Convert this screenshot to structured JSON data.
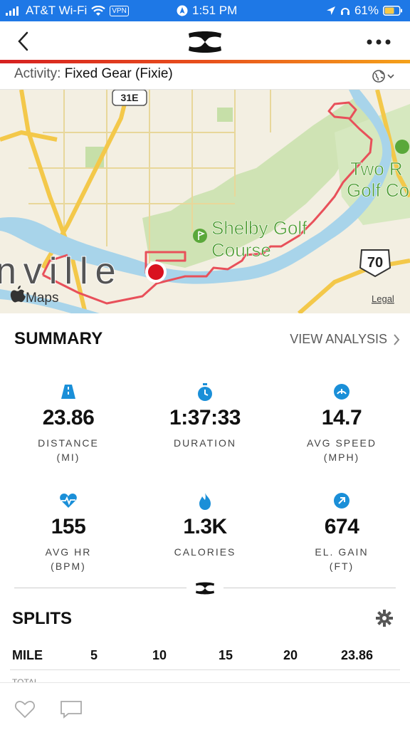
{
  "status": {
    "carrier": "AT&T Wi-Fi",
    "vpn": "VPN",
    "time": "1:51 PM",
    "battery": "61%"
  },
  "nav": {
    "back_icon": "chevron-left-icon",
    "logo_icon": "under-armour-logo",
    "more_icon": "more-dots-icon"
  },
  "activity": {
    "label": "Activity:",
    "value": "Fixed Gear (Fixie)"
  },
  "map": {
    "road_sign_1": "31E",
    "road_sign_2": "70",
    "place_1_line1": "Shelby Golf",
    "place_1_line2": "Course",
    "place_2_line1": "Two R",
    "place_2_line2": "Golf Co",
    "city_fragment": "nville",
    "maps_label": "Maps",
    "legal_label": "Legal"
  },
  "summary": {
    "title": "SUMMARY",
    "view_analysis": "VIEW ANALYSIS",
    "stats": [
      {
        "value": "23.86",
        "label": "DISTANCE",
        "unit": "(MI)"
      },
      {
        "value": "1:37:33",
        "label": "DURATION",
        "unit": ""
      },
      {
        "value": "14.7",
        "label": "AVG SPEED",
        "unit": "(MPH)"
      },
      {
        "value": "155",
        "label": "AVG HR",
        "unit": "(BPM)"
      },
      {
        "value": "1.3K",
        "label": "CALORIES",
        "unit": ""
      },
      {
        "value": "674",
        "label": "EL. GAIN",
        "unit": "(FT)"
      }
    ]
  },
  "splits": {
    "title": "SPLITS",
    "headers": [
      "MILE",
      "5",
      "10",
      "15",
      "20",
      "23.86"
    ],
    "row_label": "TOTAL"
  },
  "colors": {
    "status_bar": "#1e78e6",
    "accent_blue": "#1a8fd8",
    "route": "#e8505a"
  }
}
